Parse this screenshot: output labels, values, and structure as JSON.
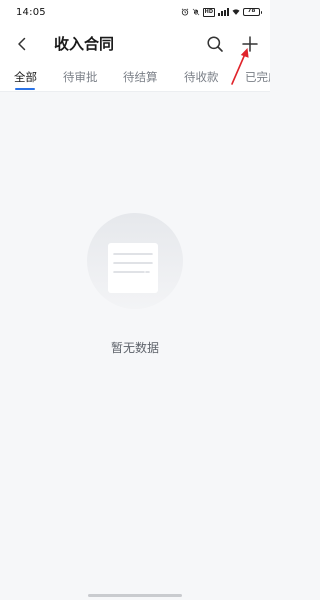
{
  "status_bar": {
    "time": "14:05",
    "battery": "78",
    "network_badge": "HD",
    "icons": [
      "alarm-icon",
      "mute-icon",
      "hd-badge",
      "signal-icon",
      "wifi-icon",
      "battery-icon"
    ]
  },
  "header": {
    "title": "收入合同",
    "back_icon": "chevron-left-icon",
    "search_icon": "search-icon",
    "add_icon": "plus-icon"
  },
  "tabs": [
    {
      "label": "全部",
      "active": true
    },
    {
      "label": "待审批",
      "active": false
    },
    {
      "label": "待结算",
      "active": false
    },
    {
      "label": "待收款",
      "active": false
    },
    {
      "label": "已完成",
      "active": false
    }
  ],
  "empty_state": {
    "icon": "empty-document-icon",
    "text": "暂无数据"
  },
  "annotation": {
    "icon": "red-arrow-icon",
    "color": "#e0242b"
  },
  "colors": {
    "accent": "#2a72e6",
    "background": "#f6f7f9"
  }
}
